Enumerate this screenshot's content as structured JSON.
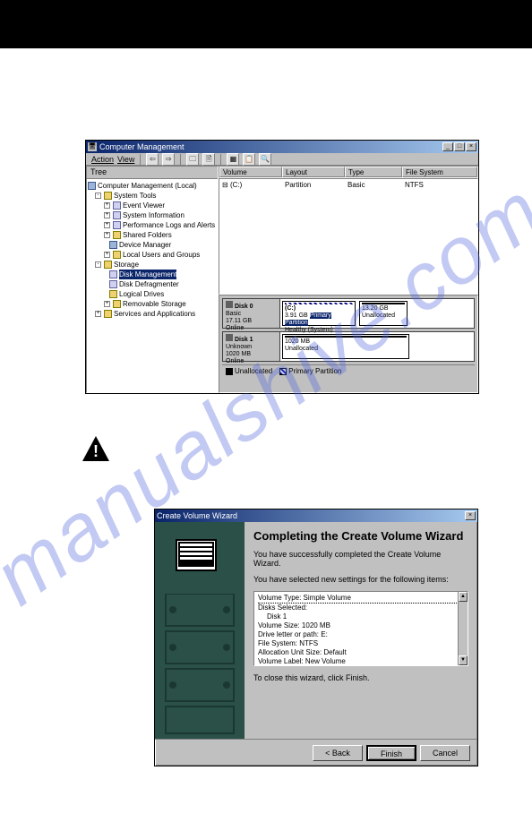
{
  "cm": {
    "title": "Computer Management",
    "menu": {
      "action": "Action",
      "view": "View"
    },
    "tree_tab": "Tree",
    "tree": {
      "root": "Computer Management (Local)",
      "system_tools": "System Tools",
      "event_viewer": "Event Viewer",
      "system_info": "System Information",
      "perf_logs": "Performance Logs and Alerts",
      "shared_folders": "Shared Folders",
      "device_mgr": "Device Manager",
      "local_users": "Local Users and Groups",
      "storage": "Storage",
      "disk_mgmt": "Disk Management",
      "disk_defrag": "Disk Defragmenter",
      "logical_drives": "Logical Drives",
      "removable": "Removable Storage",
      "services": "Services and Applications"
    },
    "headers": {
      "volume": "Volume",
      "layout": "Layout",
      "type": "Type",
      "fs": "File System"
    },
    "vol_row": {
      "name": "(C:)",
      "layout": "Partition",
      "type": "Basic",
      "fs": "NTFS"
    },
    "disk0": {
      "label": "Disk 0",
      "kind": "Basic",
      "size": "17.11 GB",
      "status": "Online",
      "p1_name": "(C:)",
      "p1_size": "3.91 GB",
      "p1_tag": "Primary Partition",
      "p1_health": "Healthy (System)",
      "p2_size": "13.20 GB",
      "p2_status": "Unallocated"
    },
    "disk1": {
      "label": "Disk 1",
      "kind": "Unknown",
      "size": "1020 MB",
      "status": "Online",
      "p1_size": "1020 MB",
      "p1_status": "Unallocated"
    },
    "legend": {
      "unalloc": "Unallocated",
      "primary": "Primary Partition"
    }
  },
  "wiz": {
    "title": "Create Volume Wizard",
    "heading": "Completing the Create Volume Wizard",
    "success": "You have successfully completed the Create Volume Wizard.",
    "selected_intro": "You have selected new settings for the following items:",
    "summary": {
      "vtype": "Volume Type: Simple Volume",
      "disks_sel": "Disks Selected:",
      "disk": "Disk 1",
      "vsize": "Volume Size: 1020 MB",
      "letter": "Drive letter or path: E:",
      "fs": "File System: NTFS",
      "alloc": "Allocation Unit Size: Default",
      "label": "Volume Label: New Volume"
    },
    "close_hint": "To close this wizard, click Finish.",
    "buttons": {
      "back": "< Back",
      "finish": "Finish",
      "cancel": "Cancel"
    }
  },
  "watermark": "manualshive.com"
}
